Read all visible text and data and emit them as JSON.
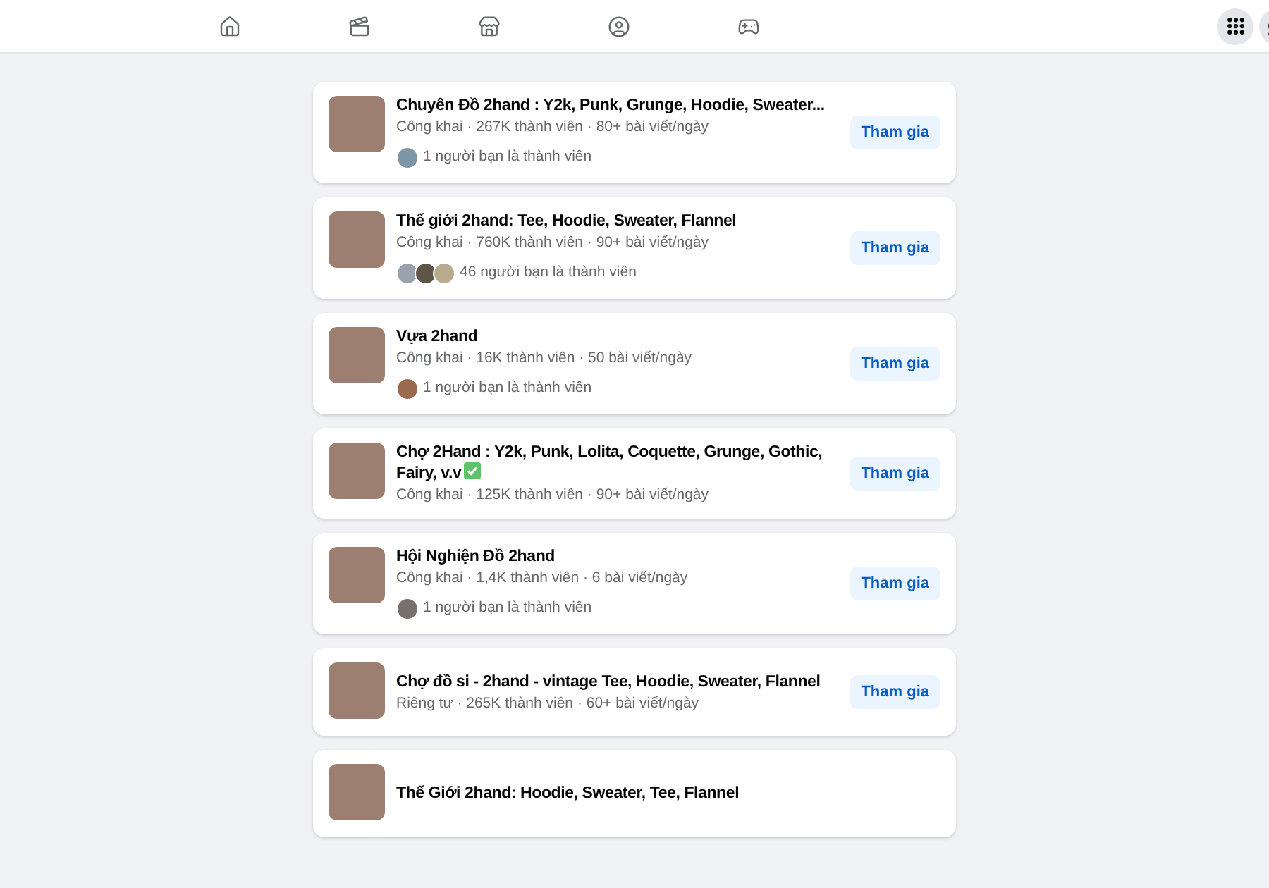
{
  "nav": {
    "tabs": [
      {
        "kind": "home",
        "selected": false
      },
      {
        "kind": "video",
        "selected": false
      },
      {
        "kind": "market",
        "selected": false
      },
      {
        "kind": "groups",
        "selected": false
      },
      {
        "kind": "gaming",
        "selected": false
      }
    ]
  },
  "groups": [
    {
      "name": "Chuyên Đồ 2hand : Y2k, Punk, Grunge, Hoodie, Sweater...",
      "check_mark": false,
      "meta": "Công khai · 267K thành viên · 80+ bài viết/ngày",
      "friend_avatars": [
        {
          "color": "#7f96a8"
        }
      ],
      "friends": "1 người bạn là thành viên",
      "button": "Tham gia"
    },
    {
      "name": "Thế giới 2hand: Tee, Hoodie, Sweater, Flannel",
      "check_mark": false,
      "meta": "Công khai · 760K thành viên · 90+ bài viết/ngày",
      "friend_avatars": [
        {
          "color": "#9aa3ad"
        },
        {
          "color": "#5e5448"
        },
        {
          "color": "#b9ab8e"
        }
      ],
      "friends": "46 người bạn là thành viên",
      "button": "Tham gia"
    },
    {
      "name": "Vựa 2hand",
      "check_mark": false,
      "meta": "Công khai · 16K thành viên · 50 bài viết/ngày",
      "friend_avatars": [
        {
          "color": "#9a6a4e"
        }
      ],
      "friends": "1 người bạn là thành viên",
      "button": "Tham gia"
    },
    {
      "name": "Chợ 2Hand : Y2k, Punk, Lolita, Coquette, Grunge, Gothic, Fairy, v.v",
      "check_mark": true,
      "meta": "Công khai · 125K thành viên · 90+ bài viết/ngày",
      "button": "Tham gia"
    },
    {
      "name": "Hội Nghiện Đồ 2hand",
      "check_mark": false,
      "meta": "Công khai · 1,4K thành viên · 6 bài viết/ngày",
      "friend_avatars": [
        {
          "color": "#77706c"
        }
      ],
      "friends": "1 người bạn là thành viên",
      "button": "Tham gia"
    },
    {
      "name": "Chợ đồ si - 2hand - vintage Tee, Hoodie, Sweater, Flannel",
      "check_mark": false,
      "meta": "Riêng tư · 265K thành viên · 60+ bài viết/ngày",
      "button": "Tham gia"
    },
    {
      "name": "Thế Giới 2hand: Hoodie, Sweater, Tee, Flannel",
      "check_mark": false
    }
  ]
}
